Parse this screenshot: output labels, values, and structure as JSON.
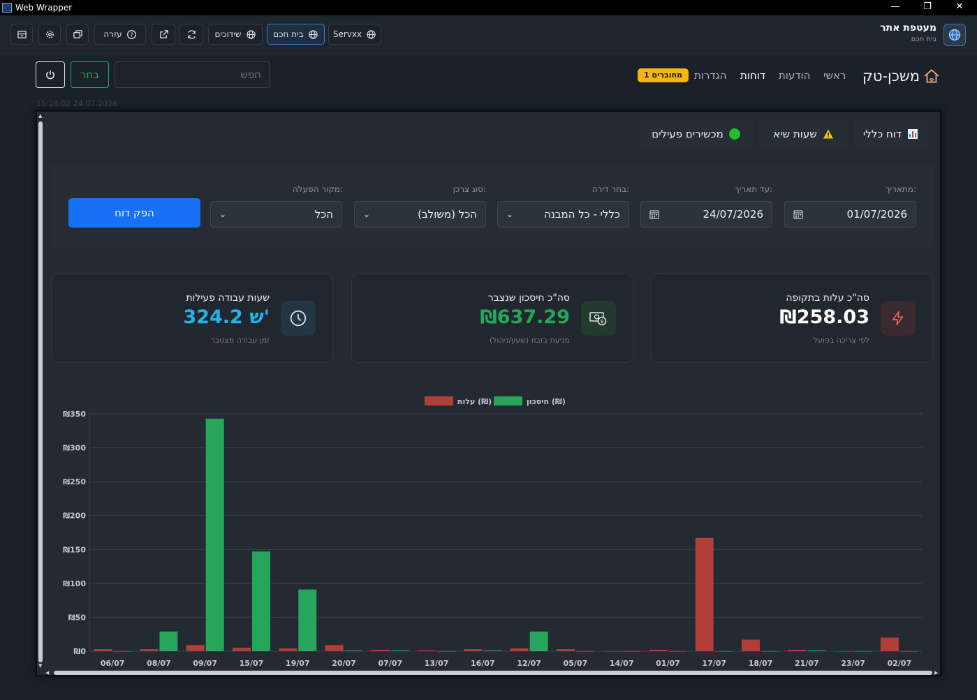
{
  "window": {
    "title": "Web Wrapper"
  },
  "wrapper": {
    "brand_title": "מעטפת אתר",
    "brand_subtitle": "בית חכם",
    "tabs": [
      {
        "label": "Servxx",
        "icon": "globe-icon",
        "active": false
      },
      {
        "label": "בית חכם",
        "icon": "globe-icon",
        "active": true
      },
      {
        "label": "שידוכים",
        "icon": "globe-icon",
        "active": false
      }
    ],
    "help_label": "עזרה"
  },
  "nav": {
    "logo": "משכן-טק",
    "items": [
      "ראשי",
      "הודעות",
      "דוחות",
      "הגדרות"
    ],
    "active_index": 2,
    "badge": "1 מחוברים",
    "search_placeholder": "חפש",
    "select_label": "בחר",
    "timestamp": "15:28:02 24.07.2026"
  },
  "report_tabs": [
    {
      "label": "דוח כללי",
      "icon": "chart-icon"
    },
    {
      "label": "שעות שיא",
      "icon": "warning-icon"
    },
    {
      "label": "מכשירים פעילים",
      "icon": "green-dot-icon"
    }
  ],
  "filters": {
    "from_label": "מתאריך:",
    "from_value": "01/07/2026",
    "to_label": "עד תאריך:",
    "to_value": "24/07/2026",
    "apartment_label": "בחר דירה:",
    "apartment_value": "כללי - כל המבנה",
    "consumer_label": "סוג צרכן:",
    "consumer_value": "הכל (משולב)",
    "source_label": "מקור הפעלה:",
    "source_value": "הכל",
    "generate_label": "הפק דוח"
  },
  "cards": [
    {
      "title": "סה\"כ עלות בתקופה",
      "value": "₪258.03",
      "subtitle": "לפי צריכה בפועל",
      "icon": "lightning-icon",
      "color": "#ffffff"
    },
    {
      "title": "סה\"כ חיסכון שנצבר",
      "value": "₪637.29",
      "subtitle": "מניעת בזבוז (שעון/ניהול)",
      "icon": "money-icon",
      "color": "#22a85a"
    },
    {
      "title": "שעות עבודה פעילות",
      "value": "324.2 ש'",
      "subtitle": "זמן עבודה מצטבר",
      "icon": "clock-icon",
      "color": "#1fb5ea"
    }
  ],
  "colors": {
    "savings": "#26a65b",
    "cost": "#b13e38",
    "accent": "#1671f7"
  },
  "chart_data": {
    "type": "bar",
    "categories": [
      "06/07",
      "08/07",
      "09/07",
      "15/07",
      "19/07",
      "20/07",
      "07/07",
      "13/07",
      "16/07",
      "12/07",
      "05/07",
      "14/07",
      "01/07",
      "17/07",
      "18/07",
      "21/07",
      "23/07",
      "02/07"
    ],
    "series": [
      {
        "name": "עלות (₪)",
        "values": [
          3,
          3,
          9,
          5,
          4,
          9,
          2,
          1,
          3,
          4,
          3,
          0,
          2,
          167,
          17,
          2,
          0,
          20
        ]
      },
      {
        "name": "חיסכון (₪)",
        "values": [
          0,
          29,
          343,
          147,
          91,
          1,
          1,
          0,
          1,
          29,
          0,
          0,
          0,
          0,
          0,
          1,
          0,
          0
        ]
      }
    ],
    "ytick_labels": [
      "₪0",
      "₪50",
      "₪100",
      "₪150",
      "₪200",
      "₪250",
      "₪300",
      "₪350"
    ],
    "ylim": [
      0,
      350
    ],
    "grid": true,
    "legend_position": "top-center"
  }
}
